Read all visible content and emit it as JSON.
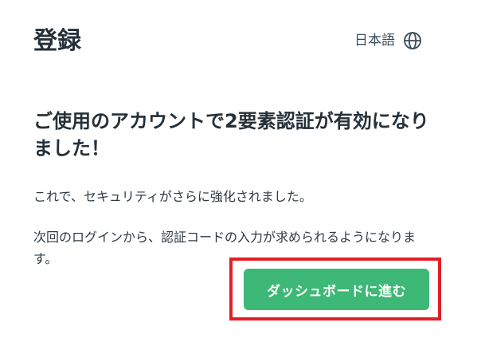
{
  "header": {
    "title": "登録",
    "language_label": "日本語",
    "language_icon": "globe-icon"
  },
  "main": {
    "heading": "ご使用のアカウントで2要素認証が有効になりました！",
    "paragraph_1": "これで、セキュリティがさらに強化されました。",
    "paragraph_2": "次回のログインから、認証コードの入力が求められるようになります。",
    "cta_label": "ダッシュボードに進む"
  },
  "colors": {
    "accent": "#3db876",
    "highlight": "#e01f27",
    "text": "#263038"
  }
}
